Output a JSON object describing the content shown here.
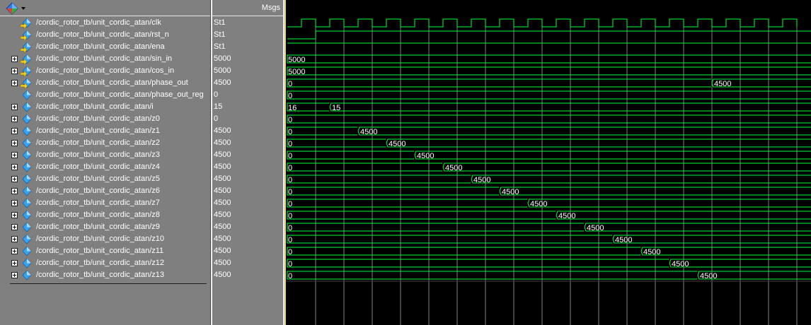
{
  "header": {
    "msgs_label": "Msgs"
  },
  "colors": {
    "wave": "#00ff3c",
    "grid": "#7f7f7f",
    "value_text": "#ffffff",
    "pane_bg": "#808080",
    "wave_bg": "#000000"
  },
  "signals": [
    {
      "name": "/cordic_rotor_tb/unit_cordic_atan/clk",
      "value": "St1",
      "kind": "wire",
      "expandable": false,
      "wave": "clk"
    },
    {
      "name": "/cordic_rotor_tb/unit_cordic_atan/rst_n",
      "value": "St1",
      "kind": "wire",
      "expandable": false,
      "wave": "rst"
    },
    {
      "name": "/cordic_rotor_tb/unit_cordic_atan/ena",
      "value": "St1",
      "kind": "wire",
      "expandable": false,
      "wave": "high"
    },
    {
      "name": "/cordic_rotor_tb/unit_cordic_atan/sin_in",
      "value": "5000",
      "kind": "input",
      "expandable": true,
      "wave": "bus",
      "segments": [
        {
          "t": 0,
          "v": "5000"
        }
      ]
    },
    {
      "name": "/cordic_rotor_tb/unit_cordic_atan/cos_in",
      "value": "5000",
      "kind": "input",
      "expandable": true,
      "wave": "bus",
      "segments": [
        {
          "t": 0,
          "v": "5000"
        }
      ]
    },
    {
      "name": "/cordic_rotor_tb/unit_cordic_atan/phase_out",
      "value": "4500",
      "kind": "output",
      "expandable": true,
      "wave": "bus",
      "segments": [
        {
          "t": 0,
          "v": "0"
        },
        {
          "t": 15,
          "v": "4500"
        }
      ]
    },
    {
      "name": "/cordic_rotor_tb/unit_cordic_atan/phase_out_reg",
      "value": "0",
      "kind": "reg",
      "expandable": false,
      "wave": "bus",
      "segments": [
        {
          "t": 0,
          "v": "0"
        }
      ]
    },
    {
      "name": "/cordic_rotor_tb/unit_cordic_atan/i",
      "value": "15",
      "kind": "reg",
      "expandable": true,
      "wave": "bus",
      "segments": [
        {
          "t": 0,
          "v": "16"
        },
        {
          "t": 1.5,
          "v": "15"
        }
      ]
    },
    {
      "name": "/cordic_rotor_tb/unit_cordic_atan/z0",
      "value": "0",
      "kind": "reg",
      "expandable": true,
      "wave": "bus",
      "segments": [
        {
          "t": 0,
          "v": "0"
        }
      ]
    },
    {
      "name": "/cordic_rotor_tb/unit_cordic_atan/z1",
      "value": "4500",
      "kind": "reg",
      "expandable": true,
      "wave": "bus",
      "segments": [
        {
          "t": 0,
          "v": "0"
        },
        {
          "t": 2.5,
          "v": "4500"
        }
      ]
    },
    {
      "name": "/cordic_rotor_tb/unit_cordic_atan/z2",
      "value": "4500",
      "kind": "reg",
      "expandable": true,
      "wave": "bus",
      "segments": [
        {
          "t": 0,
          "v": "0"
        },
        {
          "t": 3.5,
          "v": "4500"
        }
      ]
    },
    {
      "name": "/cordic_rotor_tb/unit_cordic_atan/z3",
      "value": "4500",
      "kind": "reg",
      "expandable": true,
      "wave": "bus",
      "segments": [
        {
          "t": 0,
          "v": "0"
        },
        {
          "t": 4.5,
          "v": "4500"
        }
      ]
    },
    {
      "name": "/cordic_rotor_tb/unit_cordic_atan/z4",
      "value": "4500",
      "kind": "reg",
      "expandable": true,
      "wave": "bus",
      "segments": [
        {
          "t": 0,
          "v": "0"
        },
        {
          "t": 5.5,
          "v": "4500"
        }
      ]
    },
    {
      "name": "/cordic_rotor_tb/unit_cordic_atan/z5",
      "value": "4500",
      "kind": "reg",
      "expandable": true,
      "wave": "bus",
      "segments": [
        {
          "t": 0,
          "v": "0"
        },
        {
          "t": 6.5,
          "v": "4500"
        }
      ]
    },
    {
      "name": "/cordic_rotor_tb/unit_cordic_atan/z6",
      "value": "4500",
      "kind": "reg",
      "expandable": true,
      "wave": "bus",
      "segments": [
        {
          "t": 0,
          "v": "0"
        },
        {
          "t": 7.5,
          "v": "4500"
        }
      ]
    },
    {
      "name": "/cordic_rotor_tb/unit_cordic_atan/z7",
      "value": "4500",
      "kind": "reg",
      "expandable": true,
      "wave": "bus",
      "segments": [
        {
          "t": 0,
          "v": "0"
        },
        {
          "t": 8.5,
          "v": "4500"
        }
      ]
    },
    {
      "name": "/cordic_rotor_tb/unit_cordic_atan/z8",
      "value": "4500",
      "kind": "reg",
      "expandable": true,
      "wave": "bus",
      "segments": [
        {
          "t": 0,
          "v": "0"
        },
        {
          "t": 9.5,
          "v": "4500"
        }
      ]
    },
    {
      "name": "/cordic_rotor_tb/unit_cordic_atan/z9",
      "value": "4500",
      "kind": "reg",
      "expandable": true,
      "wave": "bus",
      "segments": [
        {
          "t": 0,
          "v": "0"
        },
        {
          "t": 10.5,
          "v": "4500"
        }
      ]
    },
    {
      "name": "/cordic_rotor_tb/unit_cordic_atan/z10",
      "value": "4500",
      "kind": "reg",
      "expandable": true,
      "wave": "bus",
      "segments": [
        {
          "t": 0,
          "v": "0"
        },
        {
          "t": 11.5,
          "v": "4500"
        }
      ]
    },
    {
      "name": "/cordic_rotor_tb/unit_cordic_atan/z11",
      "value": "4500",
      "kind": "reg",
      "expandable": true,
      "wave": "bus",
      "segments": [
        {
          "t": 0,
          "v": "0"
        },
        {
          "t": 12.5,
          "v": "4500"
        }
      ]
    },
    {
      "name": "/cordic_rotor_tb/unit_cordic_atan/z12",
      "value": "4500",
      "kind": "reg",
      "expandable": true,
      "wave": "bus",
      "segments": [
        {
          "t": 0,
          "v": "0"
        },
        {
          "t": 13.5,
          "v": "4500"
        }
      ]
    },
    {
      "name": "/cordic_rotor_tb/unit_cordic_atan/z13",
      "value": "4500",
      "kind": "reg",
      "expandable": true,
      "wave": "bus",
      "segments": [
        {
          "t": 0,
          "v": "0"
        },
        {
          "t": 14.5,
          "v": "4500"
        }
      ]
    }
  ],
  "timeline": {
    "cycles": 18
  }
}
